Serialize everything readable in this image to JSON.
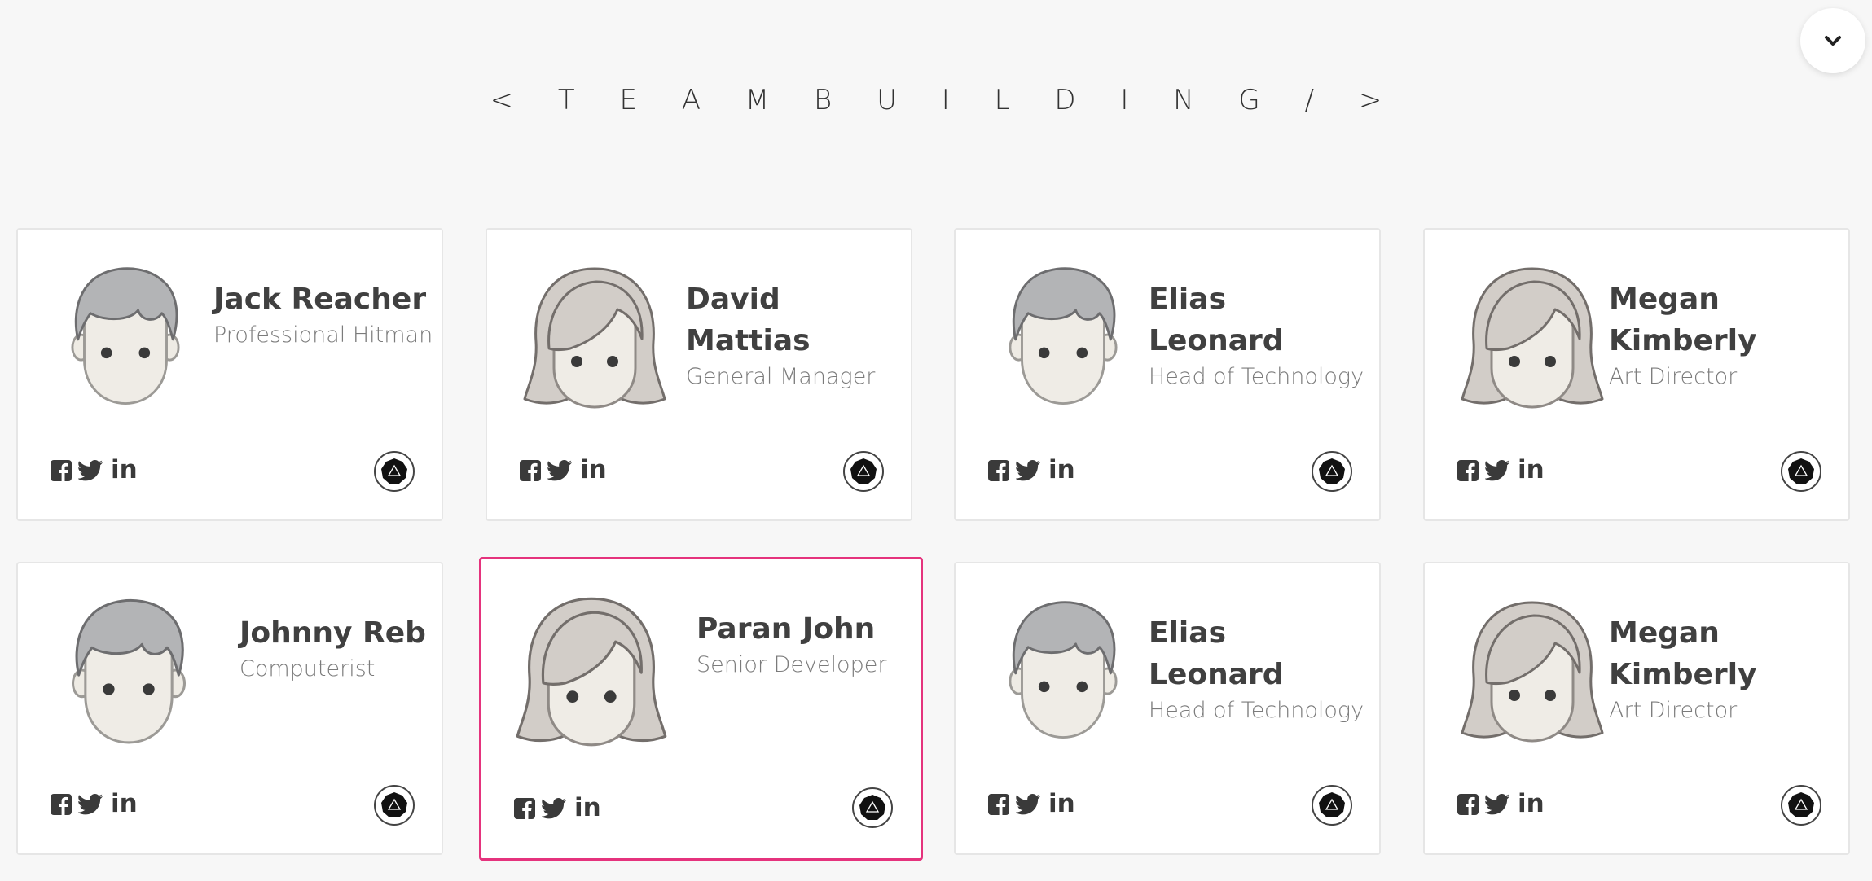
{
  "header": {
    "title": "< T E A M B U I L D I N G / >"
  },
  "scroll_button": {
    "icon": "chevron-down-icon"
  },
  "members": [
    {
      "name": "Jack Reacher",
      "role": "Professional Hitman",
      "avatar": "male"
    },
    {
      "name": "David Mattias",
      "role": "General Manager",
      "avatar": "female"
    },
    {
      "name": "Elias Leonard",
      "role": "Head of Technology",
      "avatar": "male"
    },
    {
      "name": "Megan Kimberly",
      "role": "Art Director",
      "avatar": "female"
    },
    {
      "name": "Johnny Reb",
      "role": "Computerist",
      "avatar": "male"
    },
    {
      "name": "Paran John",
      "role": "Senior Developer",
      "avatar": "female"
    },
    {
      "name": "Elias Leonard",
      "role": "Head of Technology",
      "avatar": "male"
    },
    {
      "name": "Megan Kimberly",
      "role": "Art Director",
      "avatar": "female"
    }
  ],
  "social": {
    "linkedin_label": "in"
  },
  "colors": {
    "accent": "#e5337d",
    "background": "#f7f7f7",
    "card": "#ffffff",
    "text": "#404040",
    "muted": "#7b7b7b"
  }
}
